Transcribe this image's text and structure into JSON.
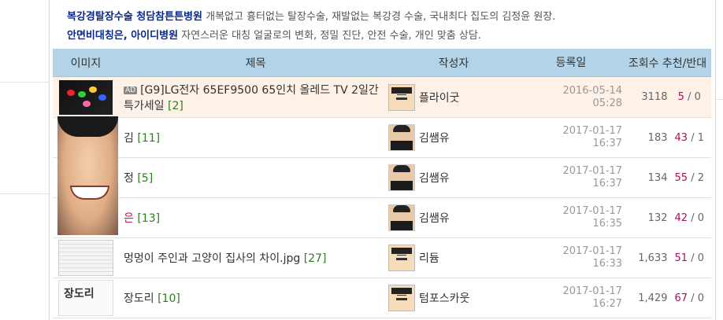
{
  "ads": [
    {
      "title": "",
      "desc": ""
    },
    {
      "title": "복강경탈장수술 청담참튼튼병원",
      "desc": "개복없고 흉터없는 탈장수술, 재발없는 복강경 수술, 국내최다 집도의 김정윤 원장."
    },
    {
      "title": "안면비대칭은, 아이디병원",
      "desc": "자연스러운 대칭 얼굴로의 변화, 정밀 진단, 안전 수술, 개인 맞춤 상담."
    }
  ],
  "table": {
    "headers": {
      "image": "이미지",
      "title": "제목",
      "author": "작성자",
      "date": "등록일",
      "views_votes": "조회수 추천/반대"
    },
    "rows": [
      {
        "ad_badge": "AD",
        "title": "[G9]LG전자 65EF9500 65인치 올레드 TV 2일간 특가세일",
        "comments": "[2]",
        "author": "플라이굿",
        "date": "2016-05-14",
        "time": "05:28",
        "views": "3118",
        "up": "5",
        "down": "0"
      },
      {
        "ad_badge": "",
        "title": "김",
        "comments": "[11]",
        "author": "김쌤유",
        "date": "2017-01-17",
        "time": "16:37",
        "views": "183",
        "up": "43",
        "down": "1"
      },
      {
        "ad_badge": "",
        "title": "정",
        "comments": "[5]",
        "author": "김쌤유",
        "date": "2017-01-17",
        "time": "16:37",
        "views": "134",
        "up": "55",
        "down": "2"
      },
      {
        "ad_badge": "",
        "title": "은",
        "comments": "[13]",
        "author": "김쌤유",
        "date": "2017-01-17",
        "time": "16:35",
        "views": "132",
        "up": "42",
        "down": "0"
      },
      {
        "ad_badge": "",
        "title": "멍멍이 주인과 고양이 집사의 차이.jpg",
        "comments": "[27]",
        "author": "리듐",
        "date": "2017-01-17",
        "time": "16:33",
        "views": "1,633",
        "up": "51",
        "down": "0"
      },
      {
        "ad_badge": "",
        "title": "장도리",
        "comments": "[10]",
        "author": "텀포스카웃",
        "date": "2017-01-17",
        "time": "16:27",
        "views": "1,429",
        "up": "67",
        "down": "0"
      }
    ],
    "vote_separator": "/",
    "thumb_text": "장도리"
  },
  "colors": {
    "header_bg": "#b3d4e8",
    "ad_row_bg": "#fdf1e8",
    "vote_up": "#a8125f",
    "comment": "#2e7d1e",
    "ad_link": "#0a2a8a"
  }
}
